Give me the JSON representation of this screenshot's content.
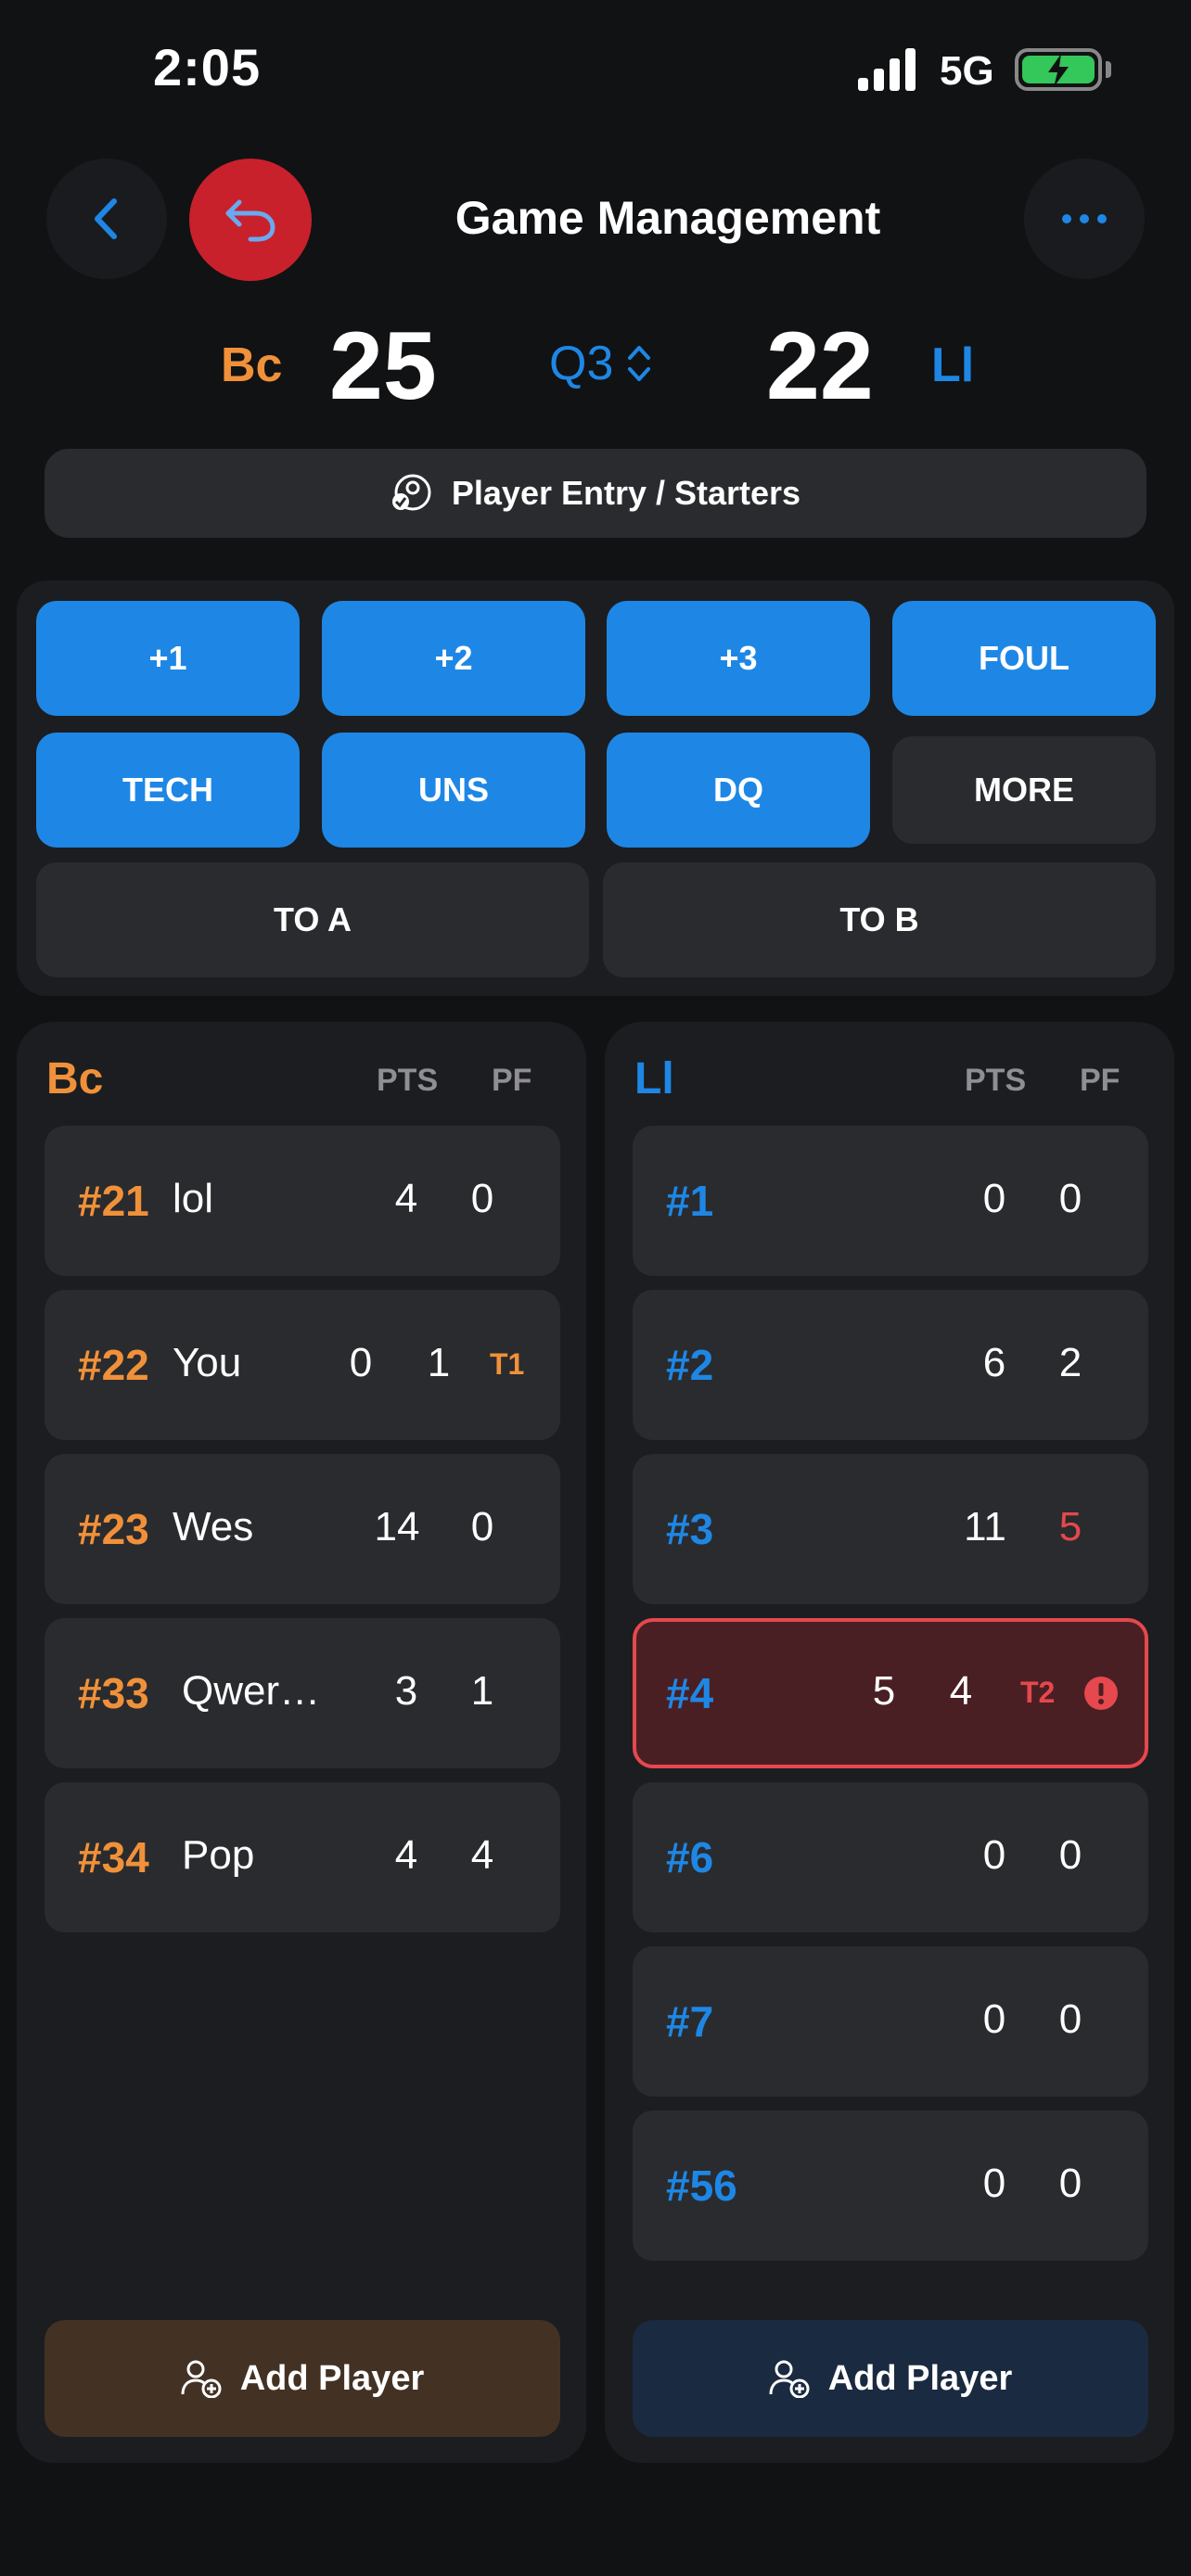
{
  "status": {
    "time": "2:05",
    "network": "5G"
  },
  "header": {
    "title": "Game Management"
  },
  "score": {
    "teamA": "Bc",
    "scoreA": "25",
    "period": "Q3",
    "scoreB": "22",
    "teamB": "Ll"
  },
  "entry_label": "Player Entry / Starters",
  "actions": {
    "plus1": "+1",
    "plus2": "+2",
    "plus3": "+3",
    "foul": "FOUL",
    "tech": "TECH",
    "uns": "UNS",
    "dq": "DQ",
    "more": "MORE",
    "to_a": "TO A",
    "to_b": "TO B"
  },
  "columns": {
    "pts": "PTS",
    "pf": "PF"
  },
  "teamA": {
    "name": "Bc",
    "players": [
      {
        "num": "#21",
        "name": "lol",
        "pts": "4",
        "pf": "0",
        "tag": ""
      },
      {
        "num": "#22",
        "name": "You",
        "pts": "0",
        "pf": "1",
        "tag": "T1"
      },
      {
        "num": "#23",
        "name": "Wes",
        "pts": "14",
        "pf": "0",
        "tag": ""
      },
      {
        "num": "#33",
        "name": "Qwer…",
        "pts": "3",
        "pf": "1",
        "tag": ""
      },
      {
        "num": "#34",
        "name": "Pop",
        "pts": "4",
        "pf": "4",
        "tag": ""
      }
    ],
    "add_label": "Add Player"
  },
  "teamB": {
    "name": "Ll",
    "players": [
      {
        "num": "#1",
        "pts": "0",
        "pf": "0",
        "tag": ""
      },
      {
        "num": "#2",
        "pts": "6",
        "pf": "2",
        "tag": ""
      },
      {
        "num": "#3",
        "pts": "11",
        "pf": "5",
        "tag": ""
      },
      {
        "num": "#4",
        "pts": "5",
        "pf": "4",
        "tag": "T2"
      },
      {
        "num": "#6",
        "pts": "0",
        "pf": "0",
        "tag": ""
      },
      {
        "num": "#7",
        "pts": "0",
        "pf": "0",
        "tag": ""
      },
      {
        "num": "#56",
        "pts": "0",
        "pf": "0",
        "tag": ""
      }
    ],
    "add_label": "Add Player"
  },
  "colors": {
    "orange": "#f0913a",
    "blue": "#1e87e5",
    "red": "#e5484d",
    "undo_red": "#c8212b"
  }
}
